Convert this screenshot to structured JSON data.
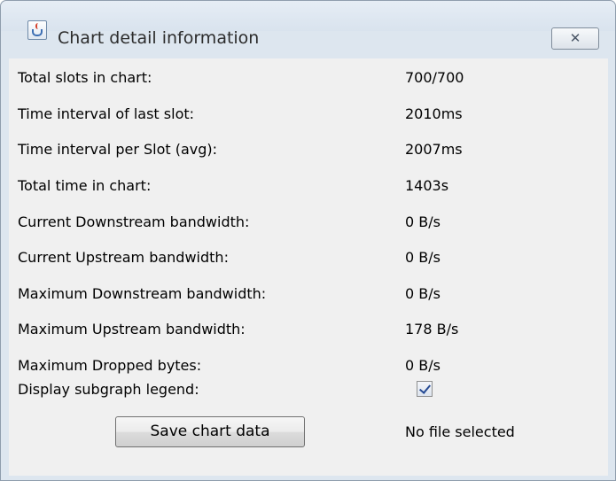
{
  "window": {
    "title": "Chart detail information",
    "close_symbol": "✕",
    "app_icon": "java-cup-icon",
    "close_icon": "close-icon"
  },
  "rows": [
    {
      "label": "Total slots in chart:",
      "value": "700/700"
    },
    {
      "label": "Time interval of last slot:",
      "value": "2010ms"
    },
    {
      "label": "Time interval per Slot (avg):",
      "value": "2007ms"
    },
    {
      "label": "Total time in chart:",
      "value": "1403s"
    },
    {
      "label": "Current Downstream bandwidth:",
      "value": "0 B/s"
    },
    {
      "label": "Current Upstream bandwidth:",
      "value": "0 B/s"
    },
    {
      "label": "Maximum Downstream bandwidth:",
      "value": "0 B/s"
    },
    {
      "label": "Maximum Upstream bandwidth:",
      "value": "178 B/s"
    },
    {
      "label": "Maximum Dropped bytes:",
      "value": "0 B/s"
    }
  ],
  "legend_option": {
    "label": "Display subgraph legend:",
    "checked": true
  },
  "save": {
    "button_label": "Save chart data",
    "file_status": "No file selected"
  }
}
